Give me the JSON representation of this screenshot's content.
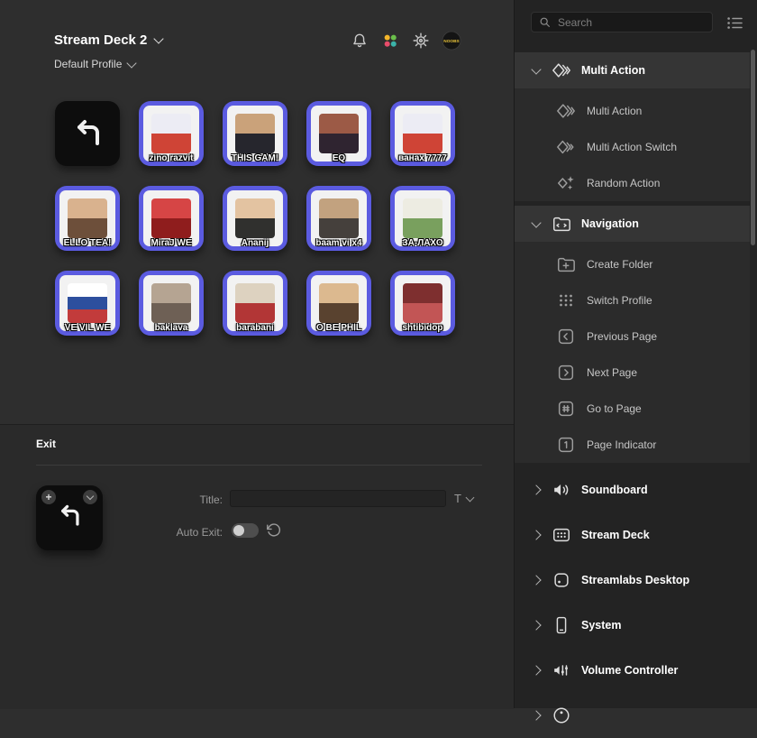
{
  "app": {
    "title": "Stream Deck 2",
    "profile": "Default Profile"
  },
  "colors": {
    "accent": "#5b5be0",
    "key_black": "#0d0d0d"
  },
  "header_icons": [
    {
      "name": "notifications-bell"
    },
    {
      "name": "plugin-store"
    },
    {
      "name": "settings-gear"
    },
    {
      "name": "profile-avatar-badge",
      "text": "NOOBS"
    }
  ],
  "keys": [
    {
      "type": "exit",
      "label": ""
    },
    {
      "type": "action",
      "label": "zino razvit",
      "art": [
        "#ececf4",
        "#cf4436"
      ]
    },
    {
      "type": "action",
      "label": "THIS GAM!",
      "art": [
        "#caa27a",
        "#26262d"
      ]
    },
    {
      "type": "action",
      "label": "EQ",
      "art": [
        "#9c5a46",
        "#2f2430"
      ]
    },
    {
      "type": "action",
      "label": "ванах 7777",
      "art": [
        "#ececf4",
        "#cf4436"
      ]
    },
    {
      "type": "action",
      "label": "ELLO TEA!",
      "art": [
        "#d9b28e",
        "#6d4f3a"
      ]
    },
    {
      "type": "action",
      "label": "MiraJ WE",
      "art": [
        "#d64545",
        "#8f1d1d"
      ]
    },
    {
      "type": "action",
      "label": "Ananij",
      "art": [
        "#e3c3a1",
        "#30302e"
      ]
    },
    {
      "type": "action",
      "label": "baam vi x4",
      "art": [
        "#c2a27f",
        "#45403c"
      ]
    },
    {
      "type": "action",
      "label": "ЗА-ЛАХО",
      "art": [
        "#edece2",
        "#79a05e"
      ]
    },
    {
      "type": "action",
      "label": "VE VIL WE",
      "art": [
        "#ffffff",
        "#2d4f9e",
        "#c23b3b"
      ]
    },
    {
      "type": "action",
      "label": "baklava",
      "art": [
        "#b5a492",
        "#6e6055"
      ]
    },
    {
      "type": "action",
      "label": "barabani",
      "art": [
        "#ddd2c0",
        "#b23636"
      ]
    },
    {
      "type": "action",
      "label": "O BE PHIL",
      "art": [
        "#dcb98f",
        "#59422f"
      ]
    },
    {
      "type": "action",
      "label": "shtibidop",
      "art": [
        "#7e2f2f",
        "#c25555"
      ]
    }
  ],
  "inspector": {
    "heading": "Exit",
    "title_label": "Title:",
    "title_value": "",
    "font_button": "T",
    "auto_exit_label": "Auto Exit:",
    "auto_exit_on": false
  },
  "sidebar": {
    "search_placeholder": "Search",
    "groups": [
      {
        "label": "Multi Action",
        "icon": "multi-action",
        "expanded": true,
        "items": [
          {
            "label": "Multi Action",
            "icon": "multi-action"
          },
          {
            "label": "Multi Action Switch",
            "icon": "multi-action-switch"
          },
          {
            "label": "Random Action",
            "icon": "random-action"
          }
        ]
      },
      {
        "label": "Navigation",
        "icon": "navigation",
        "expanded": true,
        "items": [
          {
            "label": "Create Folder",
            "icon": "create-folder"
          },
          {
            "label": "Switch Profile",
            "icon": "switch-profile"
          },
          {
            "label": "Previous Page",
            "icon": "previous-page"
          },
          {
            "label": "Next Page",
            "icon": "next-page"
          },
          {
            "label": "Go to Page",
            "icon": "go-to-page"
          },
          {
            "label": "Page Indicator",
            "icon": "page-indicator"
          }
        ]
      },
      {
        "label": "Soundboard",
        "icon": "soundboard",
        "expanded": false
      },
      {
        "label": "Stream Deck",
        "icon": "stream-deck",
        "expanded": false
      },
      {
        "label": "Streamlabs Desktop",
        "icon": "streamlabs-desktop",
        "expanded": false
      },
      {
        "label": "System",
        "icon": "system",
        "expanded": false
      },
      {
        "label": "Volume Controller",
        "icon": "volume-controller",
        "expanded": false
      },
      {
        "label": "",
        "icon": "obs-circle",
        "expanded": false,
        "partial": true
      }
    ]
  }
}
